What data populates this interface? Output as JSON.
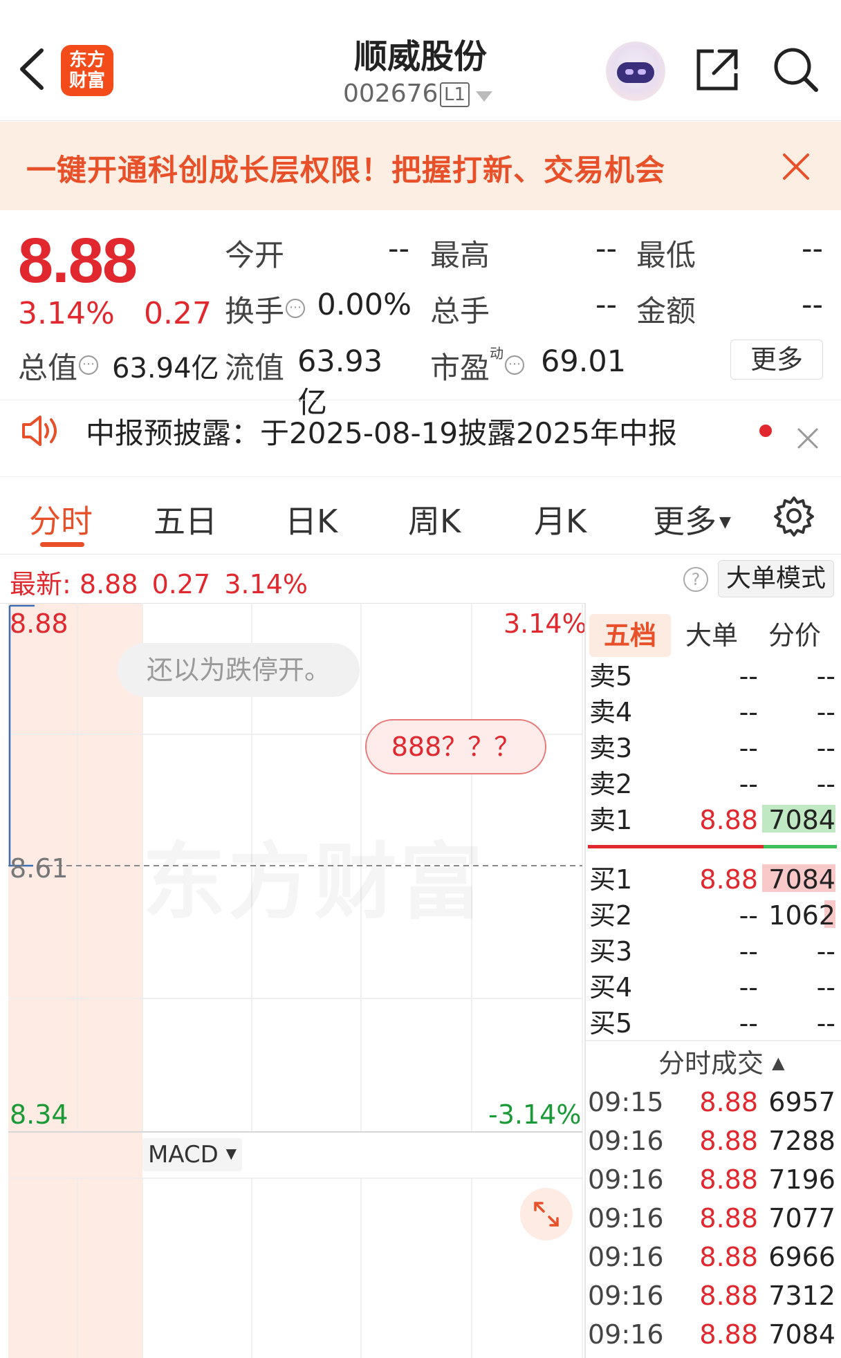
{
  "header": {
    "title": "顺威股份",
    "code": "002676",
    "level": "L1"
  },
  "logo": {
    "line1": "东方",
    "line2": "财富"
  },
  "banner": {
    "text": "一键开通科创成长层权限！把握打新、交易机会"
  },
  "quote": {
    "price": "8.88",
    "change_pct": "3.14%",
    "change": "0.27",
    "open_label": "今开",
    "open": "--",
    "high_label": "最高",
    "high": "--",
    "low_label": "最低",
    "low": "--",
    "turnover_label": "换手",
    "turnover": "0.00%",
    "volume_label": "总手",
    "volume": "--",
    "amount_label": "金额",
    "amount": "--",
    "mktcap_label": "总值",
    "mktcap": "63.94亿",
    "float_label": "流值",
    "float": "63.93亿",
    "pe_label": "市盈",
    "pe_sup": "动",
    "pe": "69.01",
    "more": "更多"
  },
  "notice": {
    "text": "中报预披露：于2025-08-19披露2025年中报"
  },
  "tabs": [
    "分时",
    "五日",
    "日K",
    "周K",
    "月K",
    "更多"
  ],
  "latest": {
    "label": "最新:",
    "price": "8.88",
    "change": "0.27",
    "pct": "3.14%"
  },
  "big_order_mode": "大单模式",
  "chart": {
    "top_price": "8.88",
    "top_pct": "3.14%",
    "mid_price": "8.61",
    "bottom_price": "8.34",
    "bottom_pct": "-3.14%",
    "watermark": "东方财富",
    "bubble1": "还以为跌停开。",
    "bubble2": "888？？？",
    "indicator": "MACD"
  },
  "orderbook": {
    "tabs": [
      "五档",
      "大单",
      "分价"
    ],
    "asks": [
      {
        "name": "卖5",
        "price": "--",
        "vol": "--"
      },
      {
        "name": "卖4",
        "price": "--",
        "vol": "--"
      },
      {
        "name": "卖3",
        "price": "--",
        "vol": "--"
      },
      {
        "name": "卖2",
        "price": "--",
        "vol": "--"
      },
      {
        "name": "卖1",
        "price": "8.88",
        "vol": "7084"
      }
    ],
    "bids": [
      {
        "name": "买1",
        "price": "8.88",
        "vol": "7084"
      },
      {
        "name": "买2",
        "price": "--",
        "vol": "1062"
      },
      {
        "name": "买3",
        "price": "--",
        "vol": "--"
      },
      {
        "name": "买4",
        "price": "--",
        "vol": "--"
      },
      {
        "name": "买5",
        "price": "--",
        "vol": "--"
      }
    ]
  },
  "ticks": {
    "title": "分时成交",
    "rows": [
      {
        "time": "09:15",
        "price": "8.88",
        "vol": "6957"
      },
      {
        "time": "09:16",
        "price": "8.88",
        "vol": "7288"
      },
      {
        "time": "09:16",
        "price": "8.88",
        "vol": "7196"
      },
      {
        "time": "09:16",
        "price": "8.88",
        "vol": "7077"
      },
      {
        "time": "09:16",
        "price": "8.88",
        "vol": "6966"
      },
      {
        "time": "09:16",
        "price": "8.88",
        "vol": "7312"
      },
      {
        "time": "09:16",
        "price": "8.88",
        "vol": "7084"
      }
    ]
  },
  "colors": {
    "up": "#e0282e",
    "down": "#1a9a36",
    "accent": "#e8502a",
    "banner_bg": "#fdeee4"
  }
}
